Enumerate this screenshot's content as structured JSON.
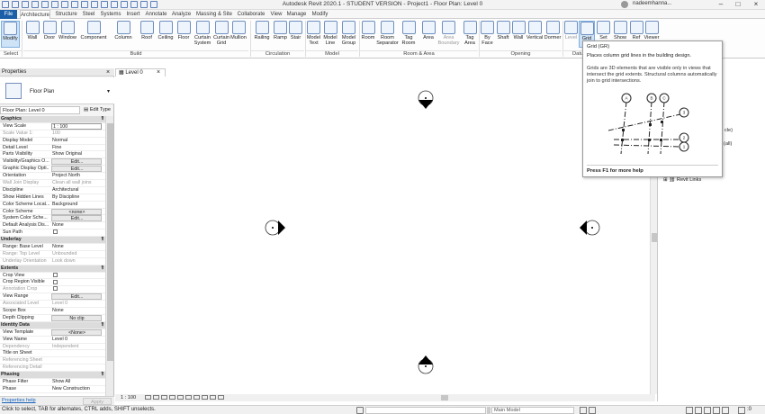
{
  "title": "Autodesk Revit 2020.1 - STUDENT VERSION - Project1 - Floor Plan: Level 0",
  "user": "nadeemhanna...",
  "tabs": [
    "File",
    "Architecture",
    "Structure",
    "Steel",
    "Systems",
    "Insert",
    "Annotate",
    "Analyze",
    "Massing & Site",
    "Collaborate",
    "View",
    "Manage",
    "Modify"
  ],
  "ribbon": {
    "buttons": [
      "Modify",
      "Wall",
      "Door",
      "Window",
      "Component",
      "Column",
      "Roof",
      "Ceiling",
      "Floor",
      "Curtain System",
      "Curtain Grid",
      "Mullion",
      "Railing",
      "Ramp",
      "Stair",
      "Model Text",
      "Model Line",
      "Model Group",
      "Room",
      "Room Separator",
      "Tag Room",
      "Area",
      "Area Boundary",
      "Tag Area",
      "By Face",
      "Shaft",
      "Wall",
      "Vertical",
      "Dormer",
      "Level",
      "Grid",
      "Set",
      "Show",
      "Ref",
      "Viewer"
    ],
    "panels": [
      "Select",
      "Build",
      "Circulation",
      "Model",
      "Room & Area",
      "Opening",
      "Datum"
    ]
  },
  "properties": {
    "header": "Properties",
    "type_name": "Floor Plan",
    "instance_selector": "Floor Plan: Level 0",
    "edit_type": "Edit Type",
    "help": "Properties help",
    "apply": "Apply",
    "rows": [
      {
        "s": "Graphics"
      },
      {
        "k": "View Scale",
        "v": "1 : 100",
        "box": true
      },
      {
        "k": "Scale Value  1:",
        "v": "100",
        "dim": true
      },
      {
        "k": "Display Model",
        "v": "Normal"
      },
      {
        "k": "Detail Level",
        "v": "Fine"
      },
      {
        "k": "Parts Visibility",
        "v": "Show Original"
      },
      {
        "k": "Visibility/Graphics O...",
        "v": "Edit...",
        "btn": true
      },
      {
        "k": "Graphic Display Opti...",
        "v": "Edit...",
        "btn": true
      },
      {
        "k": "Orientation",
        "v": "Project North"
      },
      {
        "k": "Wall Join Display",
        "v": "Clean all wall joins",
        "dim": true
      },
      {
        "k": "Discipline",
        "v": "Architectural"
      },
      {
        "k": "Show Hidden Lines",
        "v": "By Discipline"
      },
      {
        "k": "Color Scheme Locat...",
        "v": "Background"
      },
      {
        "k": "Color Scheme",
        "v": "<none>",
        "btn": true
      },
      {
        "k": "System Color Sche...",
        "v": "Edit...",
        "btn": true
      },
      {
        "k": "Default Analysis Dis...",
        "v": "None"
      },
      {
        "k": "Sun Path",
        "chk": true
      },
      {
        "s": "Underlay"
      },
      {
        "k": "Range: Base Level",
        "v": "None"
      },
      {
        "k": "Range: Top Level",
        "v": "Unbounded",
        "dim": true
      },
      {
        "k": "Underlay Orientation",
        "v": "Look down",
        "dim": true
      },
      {
        "s": "Extents"
      },
      {
        "k": "Crop View",
        "chk": true
      },
      {
        "k": "Crop Region Visible",
        "chk": true
      },
      {
        "k": "Annotation Crop",
        "chk": true,
        "dim": true
      },
      {
        "k": "View Range",
        "v": "Edit...",
        "btn": true
      },
      {
        "k": "Associated Level",
        "v": "Level 0",
        "dim": true
      },
      {
        "k": "Scope Box",
        "v": "None"
      },
      {
        "k": "Depth Clipping",
        "v": "No clip",
        "btn": true
      },
      {
        "s": "Identity Data"
      },
      {
        "k": "View Template",
        "v": "<None>",
        "btn": true
      },
      {
        "k": "View Name",
        "v": "Level 0"
      },
      {
        "k": "Dependency",
        "v": "Independent",
        "dim": true
      },
      {
        "k": "Title on Sheet",
        "v": ""
      },
      {
        "k": "Referencing Sheet",
        "v": "",
        "dim": true
      },
      {
        "k": "Referencing Detail",
        "v": "",
        "dim": true
      },
      {
        "s": "Phasing"
      },
      {
        "k": "Phase Filter",
        "v": "Show All"
      },
      {
        "k": "Phase",
        "v": "New Construction"
      }
    ]
  },
  "view": {
    "tab": "Level 0",
    "scale": "1 : 100"
  },
  "browser": {
    "item_circle": "cle)",
    "item_all": "(all)",
    "revit_links": "Revit Links"
  },
  "tooltip": {
    "title": "Grid (GR)",
    "desc": "Places column grid lines in the building design.",
    "detail": "Grids are 3D elements that are visible only in views that intersect the grid extents. Structural columns automatically join to grid intersections.",
    "help": "Press F1 for more help",
    "labels": [
      "A",
      "B",
      "C",
      "1",
      "2",
      "3"
    ]
  },
  "status": {
    "text": "Click to select, TAB for alternates, CTRL adds, SHIFT unselects.",
    "model": "Main Model",
    "count": ":0"
  },
  "colors": {
    "file_tab": "#1c5fa8",
    "accent": "#1560b8"
  }
}
